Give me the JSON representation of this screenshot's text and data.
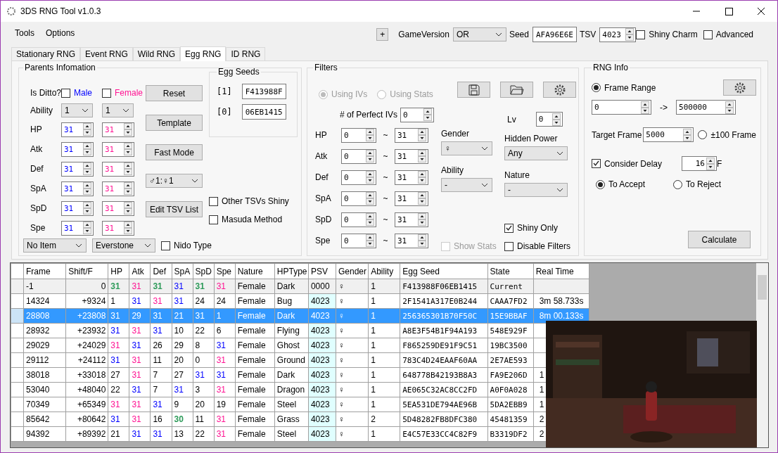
{
  "window": {
    "title": "3DS RNG Tool v1.0.3"
  },
  "menu": [
    "Tools",
    "Options"
  ],
  "toolbar": {
    "plus": "+",
    "game_version_label": "GameVersion",
    "game_version": "OR",
    "seed_label": "Seed",
    "seed": "AFA96E6E",
    "tsv_label": "TSV",
    "tsv": "4023",
    "shiny_charm": {
      "label": "Shiny Charm",
      "checked": false
    },
    "advanced": {
      "label": "Advanced",
      "checked": false
    }
  },
  "tabs": [
    {
      "label": "Stationary RNG",
      "selected": false
    },
    {
      "label": "Event RNG",
      "selected": false
    },
    {
      "label": "Wild RNG",
      "selected": false
    },
    {
      "label": "Egg RNG",
      "selected": true
    },
    {
      "label": "ID RNG",
      "selected": false
    }
  ],
  "parents": {
    "title": "Parents Infomation",
    "is_ditto_label": "Is Ditto?",
    "male": {
      "label": "Male",
      "checked": false
    },
    "female": {
      "label": "Female",
      "checked": false
    },
    "ability_label": "Ability",
    "male_ability": "1",
    "female_ability": "1",
    "stats": [
      {
        "label": "HP",
        "male": "31",
        "female": "31"
      },
      {
        "label": "Atk",
        "male": "31",
        "female": "31"
      },
      {
        "label": "Def",
        "male": "31",
        "female": "31"
      },
      {
        "label": "SpA",
        "male": "31",
        "female": "31"
      },
      {
        "label": "SpD",
        "male": "31",
        "female": "31"
      },
      {
        "label": "Spe",
        "male": "31",
        "female": "31"
      }
    ],
    "buttons": [
      "Reset",
      "Template",
      "Fast Mode"
    ],
    "ratio": "♂1:♀1",
    "edit_tsv": "Edit TSV List",
    "male_item": "No Item",
    "female_item": "Everstone",
    "nido_type": {
      "label": "Nido Type",
      "checked": false
    },
    "other_tsvs_shiny": {
      "label": "Other TSVs Shiny",
      "checked": false
    },
    "masuda_method": {
      "label": "Masuda Method",
      "checked": false
    }
  },
  "egg_seeds": {
    "title": "Egg Seeds",
    "seeds": [
      {
        "index": "[1]",
        "value": "F413988F"
      },
      {
        "index": "[0]",
        "value": "06EB1415"
      }
    ]
  },
  "filters": {
    "title": "Filters",
    "mode": [
      {
        "label": "Using IVs",
        "selected": true,
        "disabled": true
      },
      {
        "label": "Using Stats",
        "selected": false,
        "disabled": true
      }
    ],
    "perfect_ivs_label": "# of Perfect IVs",
    "perfect_ivs": "0",
    "ivs": [
      {
        "label": "HP",
        "min": "0",
        "sep": "~",
        "max": "31"
      },
      {
        "label": "Atk",
        "min": "0",
        "sep": "~",
        "max": "31"
      },
      {
        "label": "Def",
        "min": "0",
        "sep": "~",
        "max": "31"
      },
      {
        "label": "SpA",
        "min": "0",
        "sep": "~",
        "max": "31"
      },
      {
        "label": "SpD",
        "min": "0",
        "sep": "~",
        "max": "31"
      },
      {
        "label": "Spe",
        "min": "0",
        "sep": "~",
        "max": "31"
      }
    ],
    "gender_label": "Gender",
    "gender": "♀",
    "ability_label": "Ability",
    "ability": "-",
    "lv_label": "Lv",
    "lv": "0",
    "hidden_power_label": "Hidden Power",
    "hidden_power": "Any",
    "nature_label": "Nature",
    "nature": "-",
    "show_stats": {
      "label": "Show Stats",
      "checked": false,
      "disabled": true
    },
    "shiny_only": {
      "label": "Shiny Only",
      "checked": true
    },
    "disable_filters": {
      "label": "Disable Filters",
      "checked": false
    }
  },
  "rng_info": {
    "title": "RNG Info",
    "frame_range": {
      "label": "Frame Range",
      "selected": true
    },
    "frame_min": "0",
    "arrow": "->",
    "frame_max": "500000",
    "target_frame_label": "Target Frame",
    "target_frame": "5000",
    "plus_minus": {
      "label": "±100 Frame",
      "selected": false
    },
    "consider_delay": {
      "label": "Consider Delay",
      "checked": true
    },
    "delay": "16",
    "delay_unit": "F",
    "accept": [
      {
        "label": "To Accept",
        "selected": true
      },
      {
        "label": "To Reject",
        "selected": false
      }
    ],
    "calculate": "Calculate"
  },
  "table": {
    "columns": [
      "Frame",
      "Shift/F",
      "HP",
      "Atk",
      "Def",
      "SpA",
      "SpD",
      "Spe",
      "Nature",
      "HPType",
      "PSV",
      "Gender",
      "Ability",
      "Egg Seed",
      "State",
      "Real Time"
    ],
    "rows": [
      {
        "kind": "initial",
        "selected": false,
        "frame": "-1",
        "shift": "0",
        "ivs": [
          {
            "value": "31",
            "color": "#2e9b5a"
          },
          {
            "value": "31",
            "color": "#ff1493"
          },
          {
            "value": "31",
            "color": "#2e9b5a"
          },
          {
            "value": "31",
            "color": "#0000ff"
          },
          {
            "value": "31",
            "color": "#2e9b5a"
          },
          {
            "value": "31",
            "color": "#ff1493"
          }
        ],
        "nature": "Female",
        "hptype": "Dark",
        "psv": "0000",
        "gender": "♀",
        "ability": "1",
        "egg_seed": "F413988F06EB1415",
        "state": "Current"
      },
      {
        "kind": "result",
        "selected": false,
        "frame": "14324",
        "shift": "+9324",
        "ivs": [
          {
            "value": "1"
          },
          {
            "value": "31",
            "color": "#0000ff"
          },
          {
            "value": "31",
            "color": "#ff1493"
          },
          {
            "value": "31",
            "color": "#0000ff"
          },
          {
            "value": "24"
          },
          {
            "value": "24"
          }
        ],
        "nature": "Female",
        "hptype": "Bug",
        "psv": "4023",
        "gender": "♀",
        "ability": "1",
        "egg_seed": "2F1541A317E0B244",
        "state": "CAAA7FD2",
        "real_time": "3m 58.733s"
      },
      {
        "kind": "result",
        "selected": true,
        "frame": "28808",
        "shift": "+23808",
        "ivs": [
          {
            "value": "31"
          },
          {
            "value": "29"
          },
          {
            "value": "31"
          },
          {
            "value": "21"
          },
          {
            "value": "31"
          },
          {
            "value": "1"
          }
        ],
        "nature": "Female",
        "hptype": "Dark",
        "psv": "4023",
        "gender": "♀",
        "ability": "1",
        "egg_seed": "256365301B70F50C",
        "state": "15E9BBAF",
        "real_time": "8m 00.133s"
      },
      {
        "kind": "result",
        "selected": false,
        "frame": "28932",
        "shift": "+23932",
        "ivs": [
          {
            "value": "31",
            "color": "#0000ff"
          },
          {
            "value": "31",
            "color": "#ff1493"
          },
          {
            "value": "31",
            "color": "#0000ff"
          },
          {
            "value": "10"
          },
          {
            "value": "22"
          },
          {
            "value": "6"
          }
        ],
        "nature": "Female",
        "hptype": "Flying",
        "psv": "4023",
        "gender": "♀",
        "ability": "1",
        "egg_seed": "A8E3F54B1F94A193",
        "state": "548E929F"
      },
      {
        "kind": "result",
        "selected": false,
        "frame": "29029",
        "shift": "+24029",
        "ivs": [
          {
            "value": "31",
            "color": "#ff1493"
          },
          {
            "value": "31",
            "color": "#0000ff"
          },
          {
            "value": "26"
          },
          {
            "value": "29"
          },
          {
            "value": "8"
          },
          {
            "value": "31",
            "color": "#0000ff"
          }
        ],
        "nature": "Female",
        "hptype": "Ghost",
        "psv": "4023",
        "gender": "♀",
        "ability": "1",
        "egg_seed": "F865259DE91F9C51",
        "state": "19BC3500"
      },
      {
        "kind": "result",
        "selected": false,
        "frame": "29112",
        "shift": "+24112",
        "ivs": [
          {
            "value": "31",
            "color": "#0000ff"
          },
          {
            "value": "31",
            "color": "#ff1493"
          },
          {
            "value": "11"
          },
          {
            "value": "20"
          },
          {
            "value": "0"
          },
          {
            "value": "31",
            "color": "#ff1493"
          }
        ],
        "nature": "Female",
        "hptype": "Ground",
        "psv": "4023",
        "gender": "♀",
        "ability": "1",
        "egg_seed": "783C4D24EAAF60AA",
        "state": "2E7AE593"
      },
      {
        "kind": "result",
        "selected": false,
        "frame": "38018",
        "shift": "+33018",
        "ivs": [
          {
            "value": "27"
          },
          {
            "value": "31",
            "color": "#ff1493"
          },
          {
            "value": "7"
          },
          {
            "value": "27"
          },
          {
            "value": "31",
            "color": "#0000ff"
          },
          {
            "value": "31",
            "color": "#0000ff"
          }
        ],
        "nature": "Female",
        "hptype": "Dark",
        "psv": "4023",
        "gender": "♀",
        "ability": "1",
        "egg_seed": "648778B42193B8A3",
        "state": "FA9E206D",
        "real_time": "1"
      },
      {
        "kind": "result",
        "selected": false,
        "frame": "53040",
        "shift": "+48040",
        "ivs": [
          {
            "value": "22"
          },
          {
            "value": "31",
            "color": "#0000ff"
          },
          {
            "value": "7"
          },
          {
            "value": "31",
            "color": "#0000ff"
          },
          {
            "value": "3"
          },
          {
            "value": "31",
            "color": "#ff1493"
          }
        ],
        "nature": "Female",
        "hptype": "Dragon",
        "psv": "4023",
        "gender": "♀",
        "ability": "1",
        "egg_seed": "AE065C32AC8CC2FD",
        "state": "A0F0A028",
        "real_time": "1"
      },
      {
        "kind": "result",
        "selected": false,
        "frame": "70349",
        "shift": "+65349",
        "ivs": [
          {
            "value": "31",
            "color": "#ff1493"
          },
          {
            "value": "31",
            "color": "#ff1493"
          },
          {
            "value": "31",
            "color": "#0000ff"
          },
          {
            "value": "9"
          },
          {
            "value": "20"
          },
          {
            "value": "19"
          }
        ],
        "nature": "Female",
        "hptype": "Steel",
        "psv": "4023",
        "gender": "♀",
        "ability": "1",
        "egg_seed": "5EA531DE794AE96B",
        "state": "5DA2EBB9",
        "real_time": "1"
      },
      {
        "kind": "result",
        "selected": false,
        "frame": "85642",
        "shift": "+80642",
        "ivs": [
          {
            "value": "31",
            "color": "#0000ff"
          },
          {
            "value": "31",
            "color": "#ff1493"
          },
          {
            "value": "16"
          },
          {
            "value": "30",
            "color": "#2e9b5a"
          },
          {
            "value": "11"
          },
          {
            "value": "31",
            "color": "#ff1493"
          }
        ],
        "nature": "Female",
        "hptype": "Grass",
        "psv": "4023",
        "gender": "♀",
        "ability": "2",
        "egg_seed": "5D48282FB8DFC380",
        "state": "45481359",
        "real_time": "2"
      },
      {
        "kind": "result",
        "selected": false,
        "frame": "94392",
        "shift": "+89392",
        "ivs": [
          {
            "value": "21"
          },
          {
            "value": "31",
            "color": "#0000ff"
          },
          {
            "value": "31",
            "color": "#0000ff"
          },
          {
            "value": "13"
          },
          {
            "value": "22"
          },
          {
            "value": "31",
            "color": "#ff1493"
          }
        ],
        "nature": "Female",
        "hptype": "Steel",
        "psv": "4023",
        "gender": "♀",
        "ability": "1",
        "egg_seed": "E4C57E33CC4C82F9",
        "state": "B3319DF2",
        "real_time": "2"
      }
    ]
  }
}
